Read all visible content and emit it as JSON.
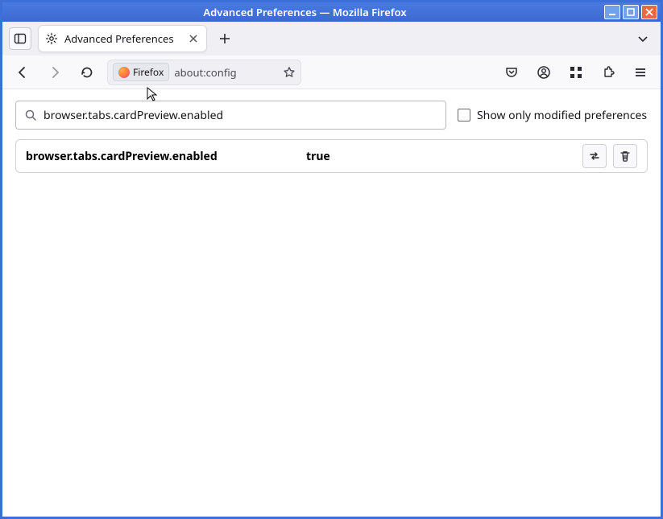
{
  "window": {
    "title": "Advanced Preferences — Mozilla Firefox"
  },
  "tab": {
    "label": "Advanced Preferences"
  },
  "urlbar": {
    "badge": "Firefox",
    "url": "about:config"
  },
  "search": {
    "value": "browser.tabs.cardPreview.enabled"
  },
  "checkbox": {
    "label": "Show only modified preferences",
    "checked": false
  },
  "result": {
    "name": "browser.tabs.cardPreview.enabled",
    "value": "true"
  }
}
